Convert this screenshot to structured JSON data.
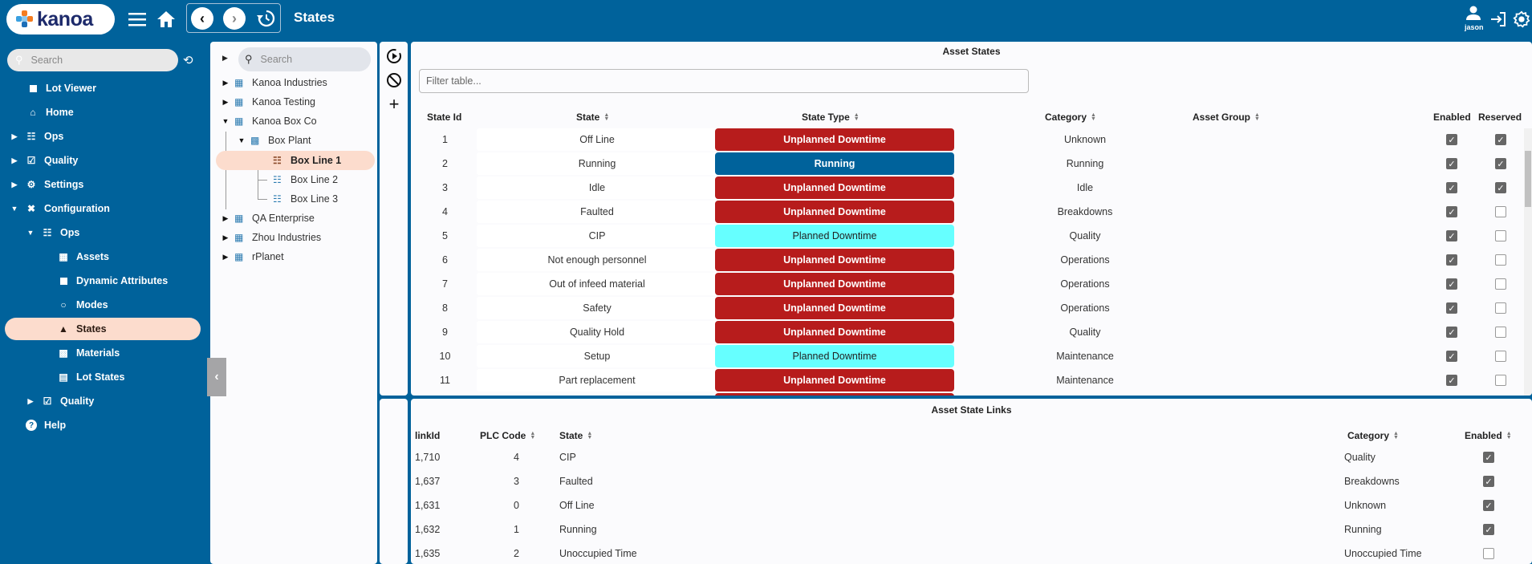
{
  "header": {
    "logo_text": "kanoa",
    "page_title": "States",
    "user_name": "jason",
    "icons": [
      "menu-icon",
      "home-icon",
      "back-icon",
      "forward-icon",
      "history-icon",
      "user-icon",
      "logout-icon",
      "settings-icon"
    ]
  },
  "sidebar": {
    "search_placeholder": "Search",
    "items": [
      {
        "label": "Lot Viewer",
        "icon": "square-icon",
        "level": 0
      },
      {
        "label": "Home",
        "icon": "home-icon",
        "level": 0
      },
      {
        "label": "Ops",
        "icon": "conveyor-icon",
        "level": 0,
        "caret": "right"
      },
      {
        "label": "Quality",
        "icon": "checklist-icon",
        "level": 0,
        "caret": "right"
      },
      {
        "label": "Settings",
        "icon": "gear-icon",
        "level": 0,
        "caret": "right"
      },
      {
        "label": "Configuration",
        "icon": "tools-icon",
        "level": 0,
        "caret": "down"
      },
      {
        "label": "Ops",
        "icon": "conveyor-icon",
        "level": 1,
        "caret": "down"
      },
      {
        "label": "Assets",
        "icon": "hierarchy-icon",
        "level": 2
      },
      {
        "label": "Dynamic Attributes",
        "icon": "square-icon",
        "level": 2
      },
      {
        "label": "Modes",
        "icon": "circle-dashed-icon",
        "level": 2
      },
      {
        "label": "States",
        "icon": "shapes-icon",
        "level": 2,
        "active": true
      },
      {
        "label": "Materials",
        "icon": "qr-icon",
        "level": 2
      },
      {
        "label": "Lot States",
        "icon": "list-icon",
        "level": 2
      },
      {
        "label": "Quality",
        "icon": "checklist-icon",
        "level": 1,
        "caret": "right"
      },
      {
        "label": "Help",
        "icon": "help-icon",
        "level": 0
      }
    ]
  },
  "tree": {
    "search_placeholder": "Search",
    "nodes": [
      {
        "label": "Kanoa Industries",
        "level": 0,
        "caret": "right"
      },
      {
        "label": "Kanoa Testing",
        "level": 0,
        "caret": "right"
      },
      {
        "label": "Kanoa Box Co",
        "level": 0,
        "caret": "down"
      },
      {
        "label": "Box Plant",
        "level": 1,
        "caret": "down"
      },
      {
        "label": "Box Line 1",
        "level": 2,
        "selected": true
      },
      {
        "label": "Box Line 2",
        "level": 2
      },
      {
        "label": "Box Line 3",
        "level": 2
      },
      {
        "label": "QA Enterprise",
        "level": 0,
        "caret": "right"
      },
      {
        "label": "Zhou Industries",
        "level": 0,
        "caret": "right"
      },
      {
        "label": "rPlanet",
        "level": 0,
        "caret": "right"
      }
    ]
  },
  "toolbar": {
    "icons": [
      "play-circle-icon",
      "block-icon",
      "add-icon"
    ]
  },
  "asset_states": {
    "title": "Asset States",
    "filter_placeholder": "Filter table...",
    "columns": [
      "State Id",
      "State",
      "State Type",
      "Category",
      "Asset Group",
      "Enabled",
      "Reserved"
    ],
    "colors": {
      "Unplanned Downtime": "#b71c1c",
      "Running": "#00629b",
      "Planned Downtime": "#66ffff"
    },
    "rows": [
      {
        "id": "1",
        "state": "Off Line",
        "type": "Unplanned Downtime",
        "category": "Unknown",
        "group": "",
        "enabled": true,
        "reserved": true
      },
      {
        "id": "2",
        "state": "Running",
        "type": "Running",
        "category": "Running",
        "group": "",
        "enabled": true,
        "reserved": true
      },
      {
        "id": "3",
        "state": "Idle",
        "type": "Unplanned Downtime",
        "category": "Idle",
        "group": "",
        "enabled": true,
        "reserved": true
      },
      {
        "id": "4",
        "state": "Faulted",
        "type": "Unplanned Downtime",
        "category": "Breakdowns",
        "group": "",
        "enabled": true,
        "reserved": false
      },
      {
        "id": "5",
        "state": "CIP",
        "type": "Planned Downtime",
        "category": "Quality",
        "group": "",
        "enabled": true,
        "reserved": false
      },
      {
        "id": "6",
        "state": "Not enough personnel",
        "type": "Unplanned Downtime",
        "category": "Operations",
        "group": "",
        "enabled": true,
        "reserved": false
      },
      {
        "id": "7",
        "state": "Out of infeed material",
        "type": "Unplanned Downtime",
        "category": "Operations",
        "group": "",
        "enabled": true,
        "reserved": false
      },
      {
        "id": "8",
        "state": "Safety",
        "type": "Unplanned Downtime",
        "category": "Operations",
        "group": "",
        "enabled": true,
        "reserved": false
      },
      {
        "id": "9",
        "state": "Quality Hold",
        "type": "Unplanned Downtime",
        "category": "Quality",
        "group": "",
        "enabled": true,
        "reserved": false
      },
      {
        "id": "10",
        "state": "Setup",
        "type": "Planned Downtime",
        "category": "Maintenance",
        "group": "",
        "enabled": true,
        "reserved": false
      },
      {
        "id": "11",
        "state": "Part replacement",
        "type": "Unplanned Downtime",
        "category": "Maintenance",
        "group": "",
        "enabled": true,
        "reserved": false
      }
    ]
  },
  "asset_state_links": {
    "title": "Asset State Links",
    "columns": [
      "linkId",
      "PLC Code",
      "State",
      "Category",
      "Enabled"
    ],
    "rows": [
      {
        "linkId": "1,710",
        "plc": "4",
        "state": "CIP",
        "category": "Quality",
        "enabled": true
      },
      {
        "linkId": "1,637",
        "plc": "3",
        "state": "Faulted",
        "category": "Breakdowns",
        "enabled": true
      },
      {
        "linkId": "1,631",
        "plc": "0",
        "state": "Off Line",
        "category": "Unknown",
        "enabled": true
      },
      {
        "linkId": "1,632",
        "plc": "1",
        "state": "Running",
        "category": "Running",
        "enabled": true
      },
      {
        "linkId": "1,635",
        "plc": "2",
        "state": "Unoccupied Time",
        "category": "Unoccupied Time",
        "enabled": false
      }
    ]
  }
}
